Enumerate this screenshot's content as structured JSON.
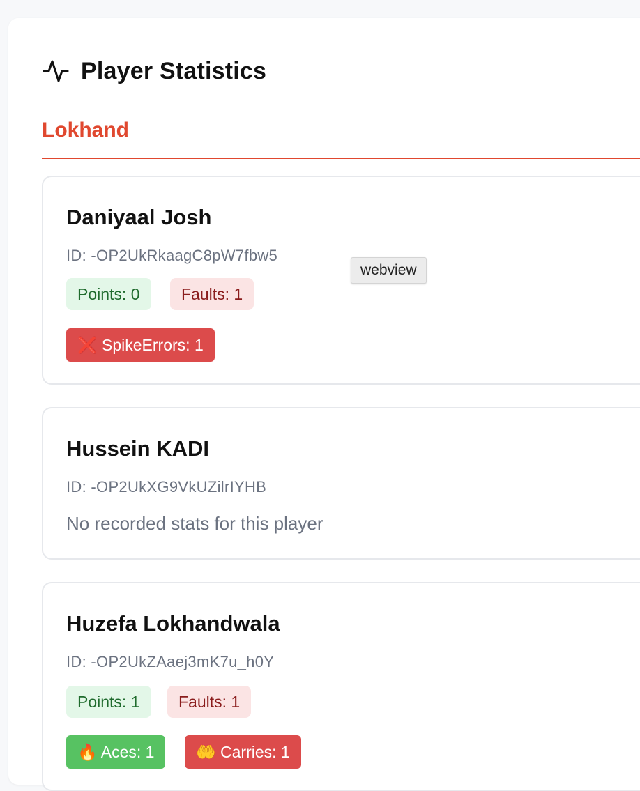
{
  "header": {
    "title": "Player Statistics",
    "icon": "activity-icon"
  },
  "team": {
    "name": "Lokhand",
    "accent": "#e0482f"
  },
  "players": [
    {
      "name": "Daniyaal Josh",
      "id": "ID: -OP2UkRkaagC8pW7fbw5",
      "points": "Points: 0",
      "faults": "Faults: 1",
      "tags": [
        "❌ SpikeErrors: 1"
      ]
    },
    {
      "name": "Hussein KADI",
      "id": "ID: -OP2UkXG9VkUZilrIYHB",
      "no_stats": "No recorded stats for this player"
    },
    {
      "name": "Huzefa Lokhandwala",
      "id": "ID: -OP2UkZAaej3mK7u_h0Y",
      "points": "Points: 1",
      "faults": "Faults: 1",
      "tags": [
        "🔥 Aces: 1",
        "🤲 Carries: 1"
      ]
    }
  ],
  "tooltip": "webview"
}
